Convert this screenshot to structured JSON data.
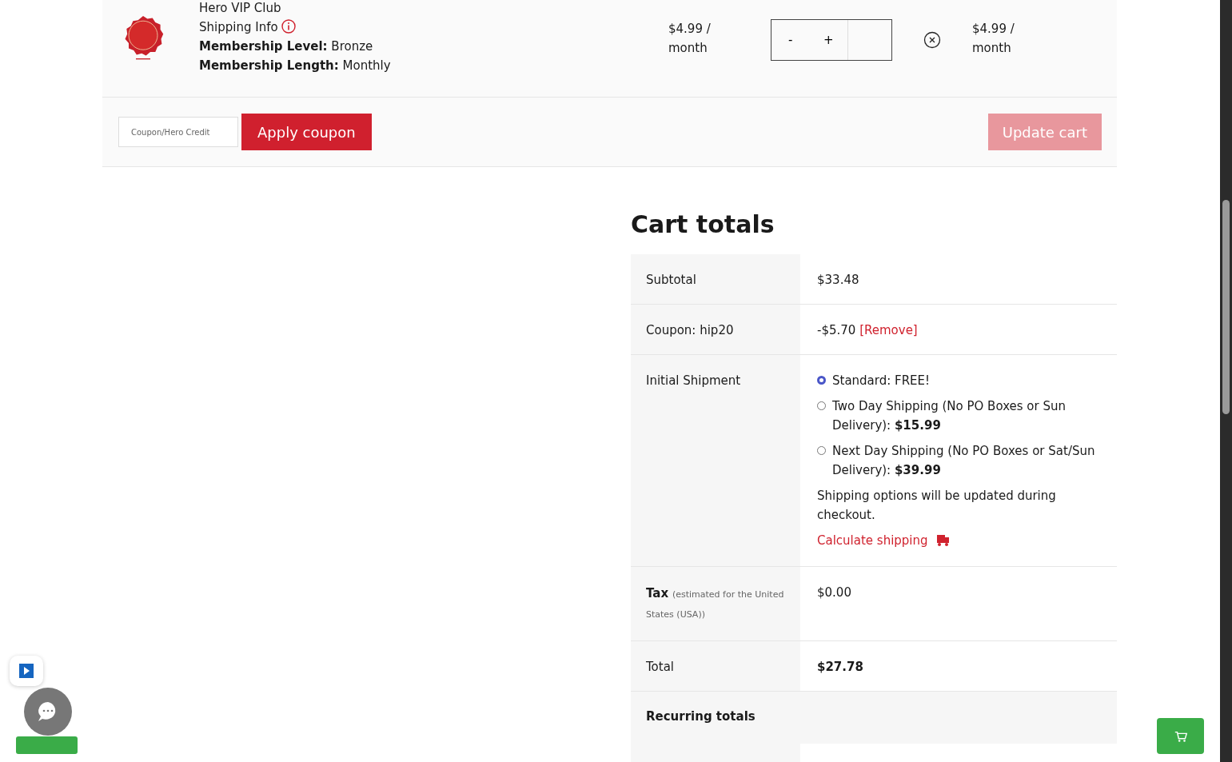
{
  "cart_item": {
    "name": "Hero VIP Club",
    "shipping_info": "Shipping Info",
    "meta": [
      {
        "label": "Membership Level:",
        "value": "Bronze"
      },
      {
        "label": "Membership Length:",
        "value": "Monthly"
      }
    ],
    "price": "$4.99 / month",
    "minus": "-",
    "plus": "+",
    "subtotal": "$4.99 / month"
  },
  "coupon": {
    "placeholder": "Coupon/Hero Credit",
    "apply": "Apply coupon",
    "update": "Update cart",
    "update_disabled": true
  },
  "cart_totals": {
    "title": "Cart totals",
    "rows": [
      {
        "kind": "plain",
        "label": "Subtotal",
        "value": "$33.48"
      },
      {
        "kind": "coupon",
        "label": "Coupon: hip20",
        "value": "-$5.70",
        "link": "[Remove]"
      },
      {
        "kind": "shipping",
        "label": "Initial Shipment",
        "options": [
          {
            "text": "Standard: FREE!",
            "selected": true
          },
          {
            "text": "Two Day Shipping (No PO Boxes or Sun Delivery): **$15.99**",
            "selected": false
          },
          {
            "text": "Next Day Shipping (No PO Boxes or Sat/Sun Delivery): **$39.99**",
            "selected": false
          }
        ],
        "note": "Shipping options will be updated during checkout.",
        "link": "Calculate shipping"
      },
      {
        "kind": "tax",
        "label": "Tax",
        "note": "(estimated for the United States (USA))",
        "value": "$0.00"
      },
      {
        "kind": "total",
        "label": "Total",
        "value": "$27.78"
      },
      {
        "kind": "heading",
        "label": "Recurring totals"
      }
    ]
  }
}
